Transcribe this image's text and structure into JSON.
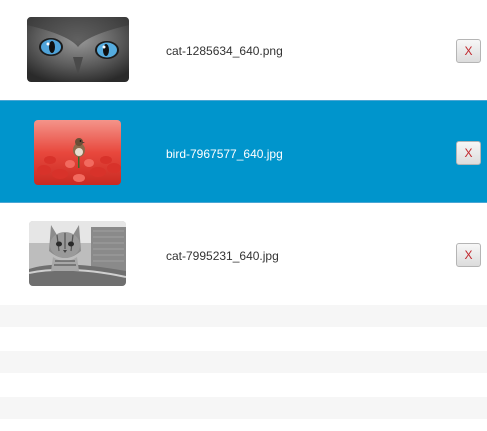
{
  "files": [
    {
      "name": "cat-1285634_640.png",
      "thumbnail": "cat-blue-eyes-image",
      "remove_label": "X",
      "selected": false
    },
    {
      "name": "bird-7967577_640.jpg",
      "thumbnail": "bird-on-red-flowers-image",
      "remove_label": "X",
      "selected": true
    },
    {
      "name": "cat-7995231_640.jpg",
      "thumbnail": "tabby-cat-bw-image",
      "remove_label": "X",
      "selected": false
    }
  ],
  "colors": {
    "selection": "#0095cc",
    "remove_text": "#c0262c",
    "empty_stripe": "#f6f6f6"
  }
}
